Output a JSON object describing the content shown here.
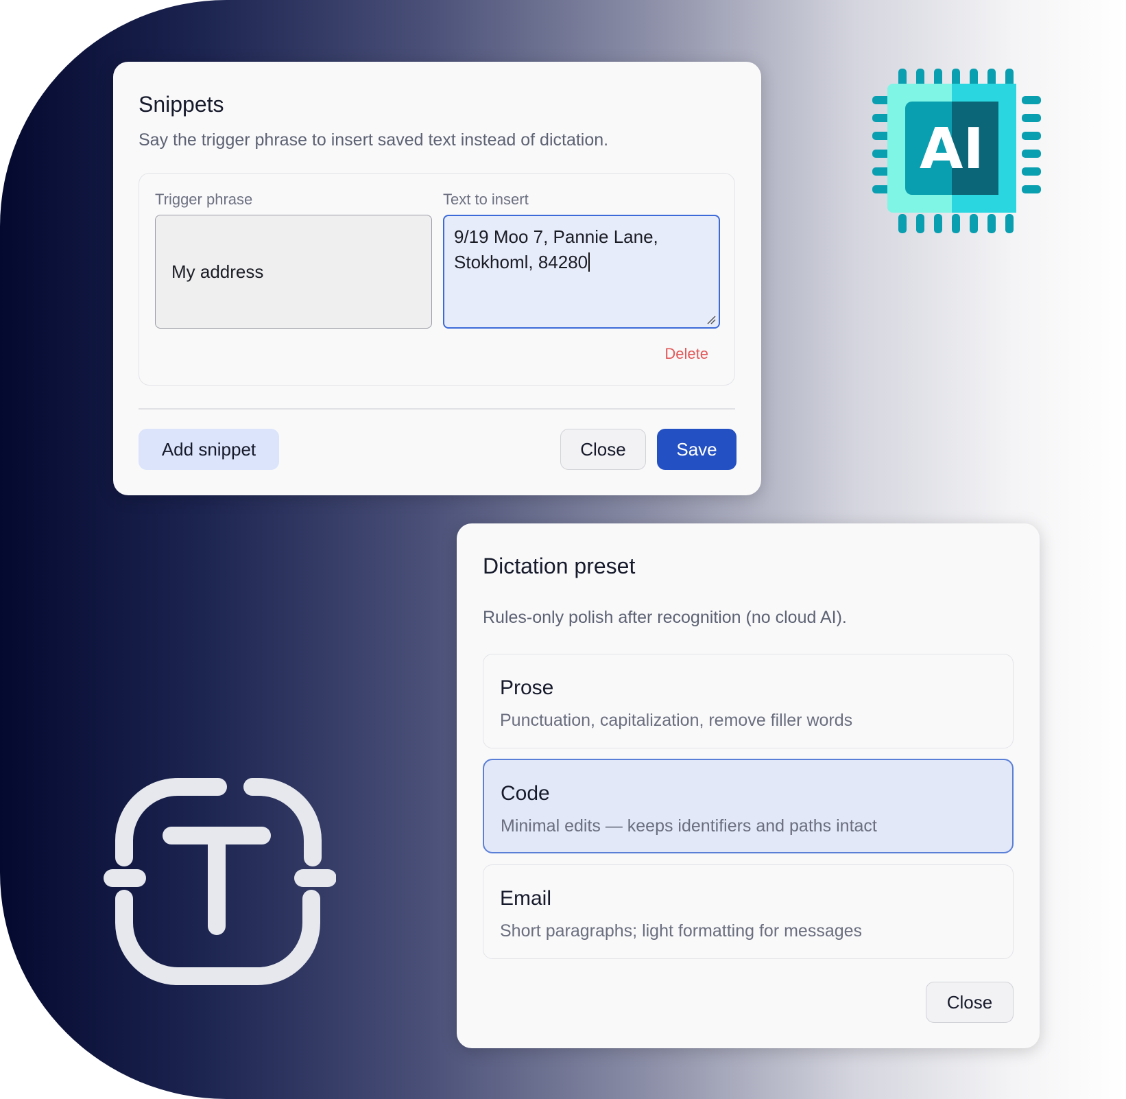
{
  "snippets": {
    "title": "Snippets",
    "subtitle": "Say the trigger phrase to insert saved text instead of dictation.",
    "trigger_label": "Trigger phrase",
    "trigger_value": "My address",
    "text_label": "Text to insert",
    "text_lines": [
      "9/19 Moo 7, Pannie Lane,",
      "Stokhoml, 84280"
    ],
    "delete_label": "Delete",
    "add_label": "Add snippet",
    "close_label": "Close",
    "save_label": "Save"
  },
  "preset": {
    "title": "Dictation preset",
    "subtitle": "Rules-only polish after recognition (no cloud AI).",
    "options": [
      {
        "name": "Prose",
        "desc": "Punctuation, capitalization, remove filler words",
        "selected": false
      },
      {
        "name": "Code",
        "desc": "Minimal edits — keeps identifiers and paths intact",
        "selected": true
      },
      {
        "name": "Email",
        "desc": "Short paragraphs; light formatting for messages",
        "selected": false
      }
    ],
    "close_label": "Close"
  },
  "logo": {
    "text": "AI",
    "colors": {
      "light": "#7ff5e6",
      "mid": "#2ad7e0",
      "dark": "#0a9fb0",
      "darkest": "#0b6777"
    }
  },
  "icons": [
    "ai-chip-logo",
    "text-recognition-icon"
  ],
  "colors": {
    "accent": "#2350c2",
    "danger": "#e25858",
    "selected_bg": "#e2e8f8"
  }
}
